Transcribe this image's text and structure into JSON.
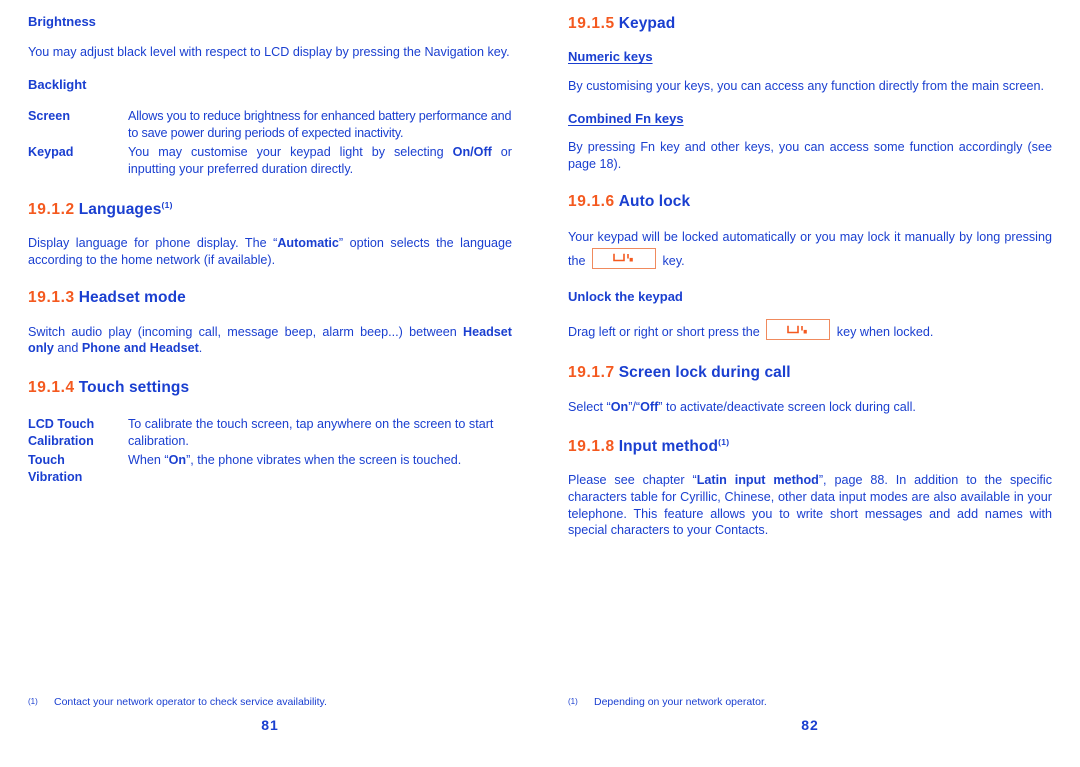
{
  "colors": {
    "text_blue": "#1a3fd0",
    "section_orange": "#f4591f",
    "key_border_orange": "#f08a5d"
  },
  "left_page": {
    "page_number": "81",
    "footnote": {
      "mark": "(1)",
      "text": "Contact your network operator to check service availability."
    },
    "blocks": {
      "brightness_heading": "Brightness",
      "brightness_body": "You may adjust black level with respect to LCD display by pressing the Navigation key.",
      "backlight_heading": "Backlight",
      "backlight_rows": [
        {
          "term": "Screen",
          "desc": "Allows you to reduce brightness for enhanced battery performance and to save power during periods of expected inactivity."
        },
        {
          "term": "Keypad",
          "desc_part1": "You may customise your keypad light by selecting ",
          "desc_bold": "On/Off",
          "desc_part2": " or inputting your preferred duration directly."
        }
      ],
      "languages": {
        "number": "19.1.2",
        "title": "Languages",
        "footnote_mark": "(1)",
        "body_part1": "Display language for phone display. The “",
        "body_bold": "Automatic",
        "body_part2": "” option selects the language according to the home network (if available)."
      },
      "headset_mode": {
        "number": "19.1.3",
        "title": "Headset mode",
        "body_part1": "Switch audio play (incoming call, message beep, alarm beep...) between ",
        "body_bold1": "Headset only",
        "body_mid": " and ",
        "body_bold2": "Phone and Headset",
        "body_part2": "."
      },
      "touch_settings": {
        "number": "19.1.4",
        "title": "Touch settings",
        "rows": [
          {
            "term_line1": "LCD Touch",
            "term_line2": "Calibration",
            "desc": "To calibrate the touch screen, tap anywhere on the screen to start calibration."
          },
          {
            "term_line1": "Touch",
            "term_line2": "Vibration",
            "desc_part1": "When “",
            "desc_bold": "On",
            "desc_part2": "”, the phone vibrates when the screen is touched."
          }
        ]
      }
    }
  },
  "right_page": {
    "page_number": "82",
    "footnote": {
      "mark": "(1)",
      "text": "Depending on your network operator."
    },
    "blocks": {
      "keypad": {
        "number": "19.1.5",
        "title": "Keypad",
        "numeric_keys_heading": "Numeric keys",
        "numeric_keys_body": "By customising your keys, you can access any function directly from the main screen.",
        "combined_fn_heading": "Combined Fn keys",
        "combined_fn_body": "By pressing Fn key and other keys, you can access some function accordingly (see page 18)."
      },
      "auto_lock": {
        "number": "19.1.6",
        "title": "Auto lock",
        "body_part1": "Your keypad will be locked automatically or you may lock it manually by long pressing the ",
        "key_icon": "keypad-lock-key-icon",
        "body_part2": " key.",
        "unlock_heading": "Unlock the keypad",
        "unlock_part1": "Drag left or right or short press the ",
        "unlock_key_icon": "keypad-lock-key-icon",
        "unlock_part2": " key when locked."
      },
      "screen_lock": {
        "number": "19.1.7",
        "title": "Screen lock during call",
        "body_part1": "Select “",
        "body_bold1": "On",
        "body_mid": "”/“",
        "body_bold2": "Off",
        "body_part2": "” to activate/deactivate screen lock during call."
      },
      "input_method": {
        "number": "19.1.8",
        "title": "Input method",
        "footnote_mark": "(1)",
        "body_part1": "Please see chapter “",
        "body_bold": "Latin input method",
        "body_part2": "”, page 88. In addition to the specific characters table for Cyrillic, Chinese, other data input modes are also available in your telephone. This feature allows you to write short messages and add names with special characters to your Contacts."
      }
    }
  }
}
